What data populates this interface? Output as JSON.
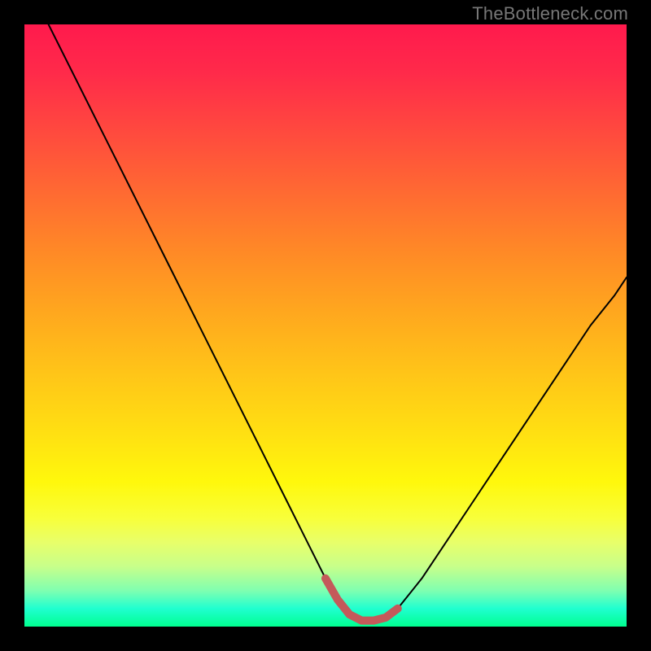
{
  "watermark": "TheBottleneck.com",
  "colors": {
    "curve_stroke": "#000000",
    "valley_stroke": "#c45a5a",
    "valley_fill": "none",
    "frame_bg": "#000000"
  },
  "chart_data": {
    "type": "line",
    "title": "",
    "xlabel": "",
    "ylabel": "",
    "xlim": [
      0,
      100
    ],
    "ylim": [
      0,
      100
    ],
    "grid": false,
    "notes": "Axes and numeric ticks are not shown in the image; values are estimated from pixels on a 0–100 scale. The curve represents bottleneck percentage (y) vs. an unlabeled x parameter, reaching a minimum near x≈56 where a short coral valley segment is drawn.",
    "series": [
      {
        "name": "bottleneck-curve",
        "x": [
          4,
          8,
          12,
          16,
          20,
          24,
          28,
          32,
          36,
          40,
          44,
          48,
          50,
          52,
          54,
          56,
          58,
          60,
          62,
          66,
          70,
          74,
          78,
          82,
          86,
          90,
          94,
          98,
          100
        ],
        "y": [
          100,
          92,
          84,
          76,
          68,
          60,
          52,
          44,
          36,
          28,
          20,
          12,
          8,
          4.5,
          2,
          1,
          1,
          1.5,
          3,
          8,
          14,
          20,
          26,
          32,
          38,
          44,
          50,
          55,
          58
        ]
      }
    ],
    "annotations": [
      {
        "name": "valley-segment",
        "x_range": [
          50,
          62
        ],
        "description": "Thick coral-colored stroke along the minimum of the curve"
      }
    ]
  }
}
